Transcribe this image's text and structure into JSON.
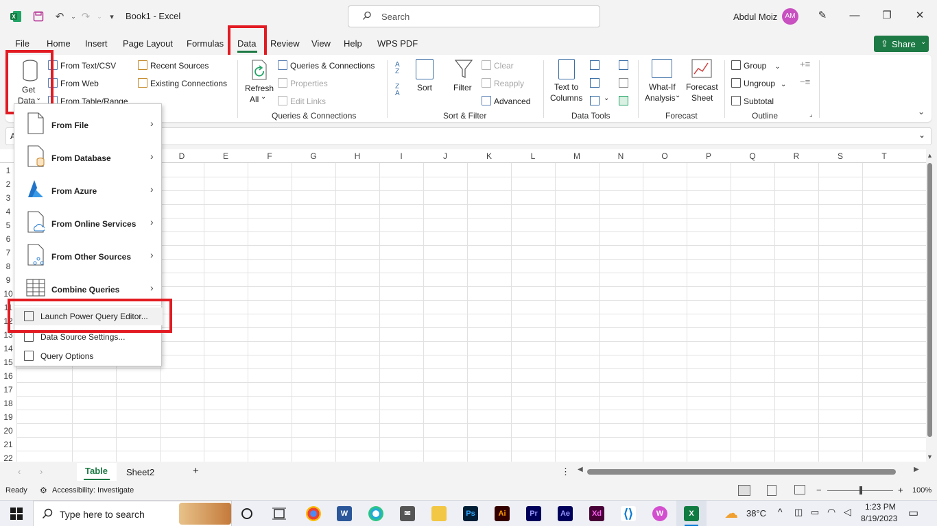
{
  "titlebar": {
    "title": "Book1  -  Excel",
    "search_placeholder": "Search",
    "user_name": "Abdul Moiz",
    "user_initials": "AM"
  },
  "menu": {
    "tabs": [
      "File",
      "Home",
      "Insert",
      "Page Layout",
      "Formulas",
      "Data",
      "Review",
      "View",
      "Help",
      "WPS PDF"
    ],
    "active": "Data",
    "share_label": "Share"
  },
  "ribbon": {
    "get_data": {
      "line1": "Get",
      "line2": "Data"
    },
    "get_transform": [
      "From Text/CSV",
      "From Web",
      "From Table/Range",
      "Recent Sources",
      "Existing Connections"
    ],
    "refresh": {
      "line1": "Refresh",
      "line2": "All"
    },
    "queries": {
      "items": [
        "Queries & Connections",
        "Properties",
        "Edit Links"
      ],
      "label": "Queries & Connections"
    },
    "sort_filter": {
      "sort": "Sort",
      "filter": "Filter",
      "clear": "Clear",
      "reapply": "Reapply",
      "advanced": "Advanced",
      "sort_az_top": "A",
      "sort_az_bottom": "Z",
      "sort_za_top": "Z",
      "sort_za_bottom": "A",
      "label": "Sort & Filter"
    },
    "data_tools": {
      "text_to_columns_1": "Text to",
      "text_to_columns_2": "Columns",
      "label": "Data Tools"
    },
    "forecast": {
      "whatif_1": "What-If",
      "whatif_2": "Analysis",
      "sheet_1": "Forecast",
      "sheet_2": "Sheet",
      "label": "Forecast"
    },
    "outline": {
      "group": "Group",
      "ungroup": "Ungroup",
      "subtotal": "Subtotal",
      "label": "Outline"
    }
  },
  "formula_bar": {
    "name_box": "A"
  },
  "grid": {
    "columns": [
      "D",
      "E",
      "F",
      "G",
      "H",
      "I",
      "J",
      "K",
      "L",
      "M",
      "N",
      "O",
      "P",
      "Q",
      "R",
      "S",
      "T"
    ],
    "rows": [
      "1",
      "2",
      "3",
      "4",
      "5",
      "6",
      "7",
      "8",
      "9",
      "10",
      "11",
      "12",
      "13",
      "14",
      "15",
      "16",
      "17",
      "18",
      "19",
      "20",
      "21",
      "22"
    ]
  },
  "get_data_menu": {
    "items": [
      {
        "label": "From File",
        "has_submenu": true,
        "icon": "file-icon"
      },
      {
        "label": "From Database",
        "has_submenu": true,
        "icon": "database-file-icon"
      },
      {
        "label": "From Azure",
        "has_submenu": true,
        "icon": "azure-icon"
      },
      {
        "label": "From Online Services",
        "has_submenu": true,
        "icon": "cloud-file-icon"
      },
      {
        "label": "From Other Sources",
        "has_submenu": true,
        "icon": "other-sources-icon"
      },
      {
        "label": "Combine Queries",
        "has_submenu": true,
        "icon": "combine-table-icon"
      }
    ],
    "actions": [
      {
        "label": "Launch Power Query Editor...",
        "icon": "power-query-editor-icon"
      },
      {
        "label": "Data Source Settings...",
        "icon": "data-source-settings-icon"
      },
      {
        "label": "Query Options",
        "icon": "query-options-icon"
      }
    ]
  },
  "sheets": {
    "tabs": [
      "Table",
      "Sheet2"
    ],
    "active": "Table",
    "add_label": "+"
  },
  "status": {
    "ready": "Ready",
    "accessibility": "Accessibility: Investigate",
    "zoom": "100%",
    "zoom_minus": "−",
    "zoom_plus": "+"
  },
  "taskbar": {
    "search_placeholder": "Type here to search",
    "weather": "38°C",
    "time": "1:23 PM",
    "date": "8/19/2023",
    "apps": [
      "Ps",
      "Ai",
      "Pr",
      "Ae",
      "Xd"
    ]
  },
  "colors": {
    "excel_green": "#1e7a45",
    "highlight_red": "#e21b22",
    "avatar": "#c850c0"
  }
}
